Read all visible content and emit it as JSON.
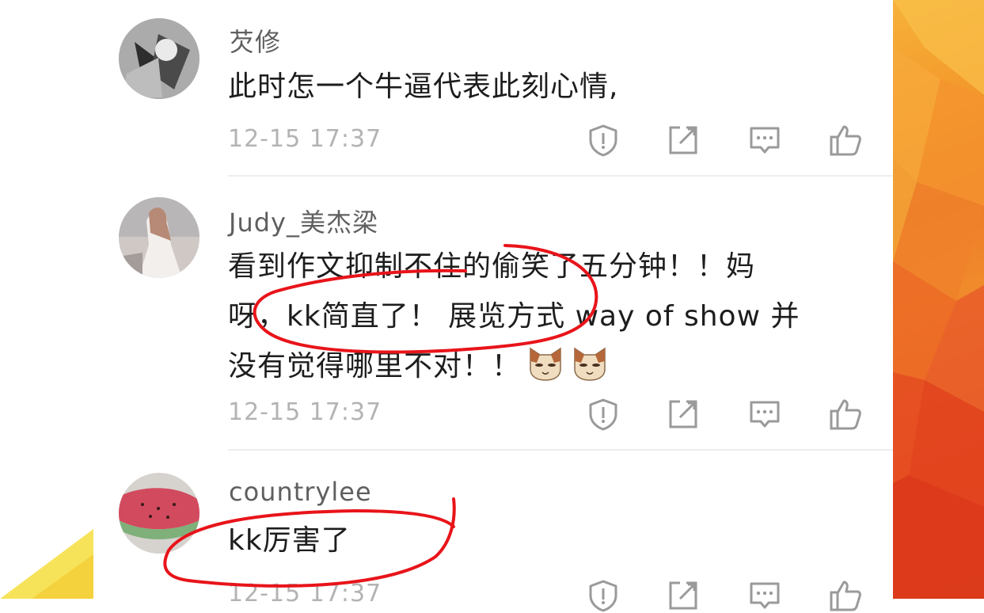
{
  "comments": [
    {
      "username": "芡修",
      "text": "此时怎一个牛逼代表此刻心情,",
      "time": "12-15 17:37"
    },
    {
      "username": "Judy_美杰梁",
      "text_line1": "看到作文抑制不住的偷笑了五分钟！！妈",
      "text_line2": "呀，kk简直了！ 展览方式  way of show 并",
      "text_line3": "没有觉得哪里不对！！",
      "time": "12-15 17:37"
    },
    {
      "username": "countrylee",
      "text": "kk厉害了",
      "time": "12-15 17:37"
    }
  ],
  "actions": [
    "report-icon",
    "share-icon",
    "reply-icon",
    "like-icon"
  ],
  "colors": {
    "username": "#5f5f5f",
    "body_text": "#1d1d1d",
    "timestamp": "#b3b3b3",
    "icon": "#9a9a9a",
    "annotation_red": "#e8141a",
    "bg_orange": "#ee7a2a"
  }
}
